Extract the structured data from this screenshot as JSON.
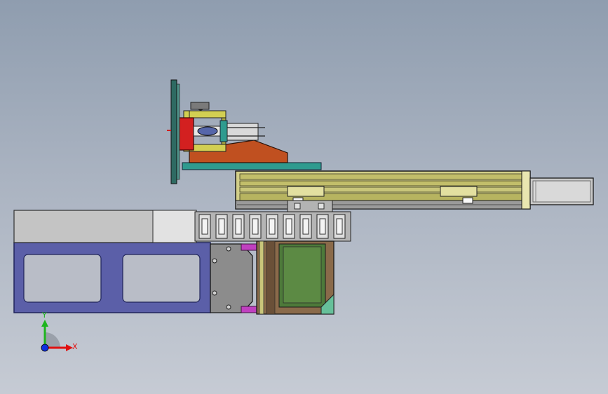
{
  "viewport": {
    "background_top": "#8f9daf",
    "background_bottom": "#c6cbd4"
  },
  "triad": {
    "y_label": "Y",
    "x_label": "X",
    "y_color": "#1db51d",
    "x_color": "#e01010",
    "z_color": "#1030e0"
  },
  "colors": {
    "base_plate": "#5b5fa8",
    "cover": "#c8c8c8",
    "rail_body": "#c9c67a",
    "rail_dark": "#3e3e22",
    "bracket_yellow": "#d2cf52",
    "red_part": "#d32020",
    "orange_wedge": "#c05020",
    "teal_plate": "#2f9b8f",
    "motor_grey": "#8f8f8f",
    "gear_box_brown": "#8a6a4a",
    "gear_box_green": "#4d7a3a",
    "magenta_tab": "#c040c0"
  },
  "parts": [
    "base-plate",
    "cover-panel",
    "cable-chain",
    "linear-rail",
    "rail-end-cap",
    "motor-housing",
    "gearbox",
    "mounting-bracket",
    "gripper-assembly",
    "wedge-support",
    "vertical-plate"
  ]
}
